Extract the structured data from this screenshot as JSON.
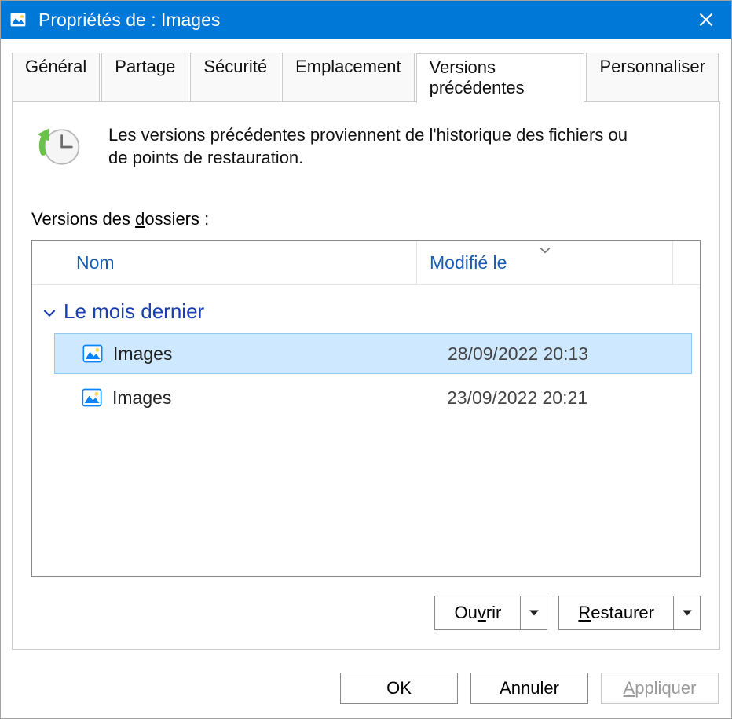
{
  "titlebar": {
    "title": "Propriétés de : Images"
  },
  "tabs": {
    "general": "Général",
    "partage": "Partage",
    "securite": "Sécurité",
    "emplacement": "Emplacement",
    "versions": "Versions précédentes",
    "personnaliser": "Personnaliser"
  },
  "intro_text": "Les versions précédentes proviennent de l'historique des fichiers ou de points de restauration.",
  "section_label_pre": "Versions des ",
  "section_label_u": "d",
  "section_label_post": "ossiers :",
  "columns": {
    "name": "Nom",
    "modified": "Modifié le"
  },
  "group_label": "Le mois dernier",
  "rows": [
    {
      "name": "Images",
      "modified": "28/09/2022 20:13",
      "selected": true
    },
    {
      "name": "Images",
      "modified": "23/09/2022 20:21",
      "selected": false
    }
  ],
  "buttons": {
    "open_pre": "Ou",
    "open_u": "v",
    "open_post": "rir",
    "restore_pre": "",
    "restore_u": "R",
    "restore_post": "estaurer",
    "ok": "OK",
    "cancel": "Annuler",
    "apply_pre": "",
    "apply_u": "A",
    "apply_post": "ppliquer"
  }
}
